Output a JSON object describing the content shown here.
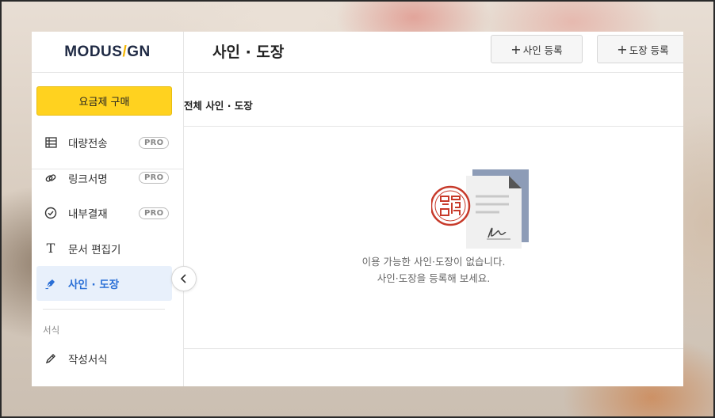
{
  "logo": {
    "part1": "MODUS",
    "slash": "/",
    "part2": "GN"
  },
  "sidebar": {
    "buy_label": "요금제 구매",
    "items": [
      {
        "label": "대량전송",
        "pro": "PRO",
        "icon": "table-icon"
      },
      {
        "label": "링크서명",
        "pro": "PRO",
        "icon": "link-icon"
      },
      {
        "label": "내부결재",
        "pro": "PRO",
        "icon": "check-circle-icon"
      },
      {
        "label": "문서 편집기",
        "icon": "text-icon"
      },
      {
        "label": "사인 · 도장",
        "icon": "pen-nib-icon",
        "active": true
      }
    ],
    "section_label": "서식",
    "template_item": {
      "label": "작성서식",
      "icon": "pencil-icon"
    }
  },
  "header": {
    "title": "사인 · 도장",
    "add_sign_label": "사인 등록",
    "add_stamp_label": "도장 등록"
  },
  "subheader": {
    "title": "전체 사인 · 도장"
  },
  "empty_state": {
    "line1": "이용 가능한 사인·도장이 없습니다.",
    "line2": "사인·도장을 등록해 보세요."
  },
  "colors": {
    "accent": "#ffd21f",
    "active": "#2a6fd6",
    "brand": "#1f2a44"
  }
}
